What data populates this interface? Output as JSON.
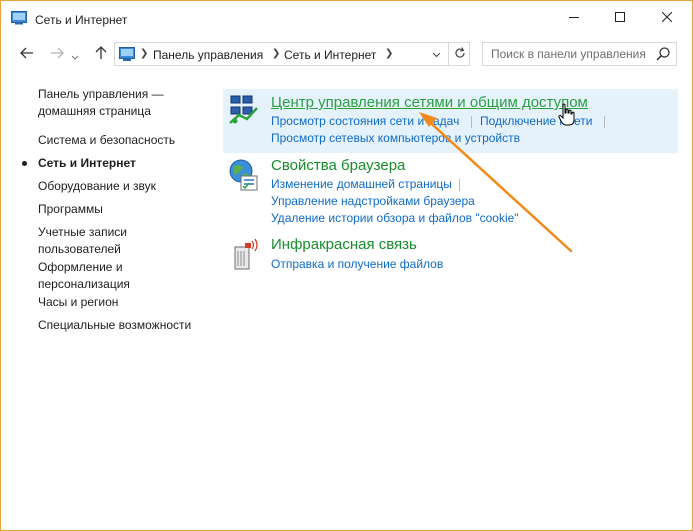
{
  "window": {
    "title": "Сеть и Интернет",
    "title_icon": "network-folder-icon",
    "controls": [
      "minimize-icon",
      "maximize-icon",
      "close-icon"
    ]
  },
  "address_bar": {
    "breadcrumbs": [
      "Панель управления",
      "Сеть и Интернет"
    ],
    "search_placeholder": "Поиск в панели управления"
  },
  "sidebar": {
    "items": [
      {
        "label": "Панель управления — домашняя страница",
        "active": false
      },
      {
        "label": "Система и безопасность",
        "active": false
      },
      {
        "label": "Сеть и Интернет",
        "active": true
      },
      {
        "label": "Оборудование и звук",
        "active": false
      },
      {
        "label": "Программы",
        "active": false
      },
      {
        "label": "Учетные записи пользователей",
        "active": false
      },
      {
        "label": "Оформление и персонализация",
        "active": false
      },
      {
        "label": "Часы и регион",
        "active": false
      },
      {
        "label": "Специальные возможности",
        "active": false
      }
    ]
  },
  "categories": [
    {
      "title": "Центр управления сетями и общим доступом",
      "icon": "network-sharing-center-icon",
      "highlighted": true,
      "links": [
        "Просмотр состояния сети и задач",
        "Подключение к сети",
        "Просмотр сетевых компьютеров и устройств"
      ]
    },
    {
      "title": "Свойства браузера",
      "icon": "browser-properties-icon",
      "highlighted": false,
      "links": [
        "Изменение домашней страницы",
        "Управление надстройками браузера",
        "Удаление истории обзора и файлов \"cookie\""
      ]
    },
    {
      "title": "Инфракрасная связь",
      "icon": "infrared-icon",
      "highlighted": false,
      "links": [
        "Отправка и получение файлов"
      ]
    }
  ],
  "colors": {
    "category_title": "#168d2a",
    "link": "#0f6bc5",
    "highlight_bg": "#e6f2fb",
    "annotation_arrow": "#f28a1a",
    "window_border": "#e8a33a"
  }
}
